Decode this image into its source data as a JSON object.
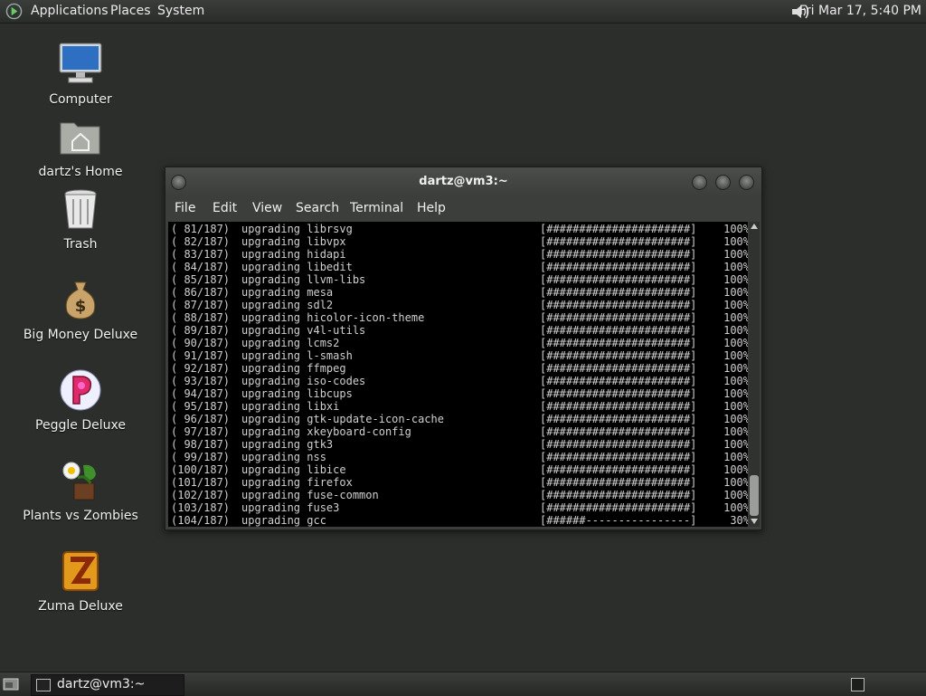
{
  "top_panel": {
    "menus": [
      "Applications",
      "Places",
      "System"
    ],
    "clock": "Fri Mar 17,  5:40 PM"
  },
  "desktop_icons": [
    {
      "label": "Computer",
      "icon": "computer-icon"
    },
    {
      "label": "dartz's Home",
      "icon": "home-folder-icon"
    },
    {
      "label": "Trash",
      "icon": "trash-icon"
    },
    {
      "label": "Big Money Deluxe",
      "icon": "money-bag-icon"
    },
    {
      "label": "Peggle Deluxe",
      "icon": "peggle-icon"
    },
    {
      "label": "Plants vs Zombies",
      "icon": "plants-vs-zombies-icon"
    },
    {
      "label": "Zuma Deluxe",
      "icon": "zuma-icon"
    }
  ],
  "terminal": {
    "title": "dartz@vm3:~",
    "menu": [
      "File",
      "Edit",
      "View",
      "Search",
      "Terminal",
      "Help"
    ],
    "lines": [
      {
        "num": "( 81/187)",
        "msg": "upgrading librsvg",
        "bar": "[######################]",
        "pct": "100%"
      },
      {
        "num": "( 82/187)",
        "msg": "upgrading libvpx",
        "bar": "[######################]",
        "pct": "100%"
      },
      {
        "num": "( 83/187)",
        "msg": "upgrading hidapi",
        "bar": "[######################]",
        "pct": "100%"
      },
      {
        "num": "( 84/187)",
        "msg": "upgrading libedit",
        "bar": "[######################]",
        "pct": "100%"
      },
      {
        "num": "( 85/187)",
        "msg": "upgrading llvm-libs",
        "bar": "[######################]",
        "pct": "100%"
      },
      {
        "num": "( 86/187)",
        "msg": "upgrading mesa",
        "bar": "[######################]",
        "pct": "100%"
      },
      {
        "num": "( 87/187)",
        "msg": "upgrading sdl2",
        "bar": "[######################]",
        "pct": "100%"
      },
      {
        "num": "( 88/187)",
        "msg": "upgrading hicolor-icon-theme",
        "bar": "[######################]",
        "pct": "100%"
      },
      {
        "num": "( 89/187)",
        "msg": "upgrading v4l-utils",
        "bar": "[######################]",
        "pct": "100%"
      },
      {
        "num": "( 90/187)",
        "msg": "upgrading lcms2",
        "bar": "[######################]",
        "pct": "100%"
      },
      {
        "num": "( 91/187)",
        "msg": "upgrading l-smash",
        "bar": "[######################]",
        "pct": "100%"
      },
      {
        "num": "( 92/187)",
        "msg": "upgrading ffmpeg",
        "bar": "[######################]",
        "pct": "100%"
      },
      {
        "num": "( 93/187)",
        "msg": "upgrading iso-codes",
        "bar": "[######################]",
        "pct": "100%"
      },
      {
        "num": "( 94/187)",
        "msg": "upgrading libcups",
        "bar": "[######################]",
        "pct": "100%"
      },
      {
        "num": "( 95/187)",
        "msg": "upgrading libxi",
        "bar": "[######################]",
        "pct": "100%"
      },
      {
        "num": "( 96/187)",
        "msg": "upgrading gtk-update-icon-cache",
        "bar": "[######################]",
        "pct": "100%"
      },
      {
        "num": "( 97/187)",
        "msg": "upgrading xkeyboard-config",
        "bar": "[######################]",
        "pct": "100%"
      },
      {
        "num": "( 98/187)",
        "msg": "upgrading gtk3",
        "bar": "[######################]",
        "pct": "100%"
      },
      {
        "num": "( 99/187)",
        "msg": "upgrading nss",
        "bar": "[######################]",
        "pct": "100%"
      },
      {
        "num": "(100/187)",
        "msg": "upgrading libice",
        "bar": "[######################]",
        "pct": "100%"
      },
      {
        "num": "(101/187)",
        "msg": "upgrading firefox",
        "bar": "[######################]",
        "pct": "100%"
      },
      {
        "num": "(102/187)",
        "msg": "upgrading fuse-common",
        "bar": "[######################]",
        "pct": "100%"
      },
      {
        "num": "(103/187)",
        "msg": "upgrading fuse3",
        "bar": "[######################]",
        "pct": "100%"
      },
      {
        "num": "(104/187)",
        "msg": "upgrading gcc",
        "bar": "[######----------------]",
        "pct": "30%"
      }
    ]
  },
  "taskbar": {
    "task_label": "dartz@vm3:~"
  }
}
